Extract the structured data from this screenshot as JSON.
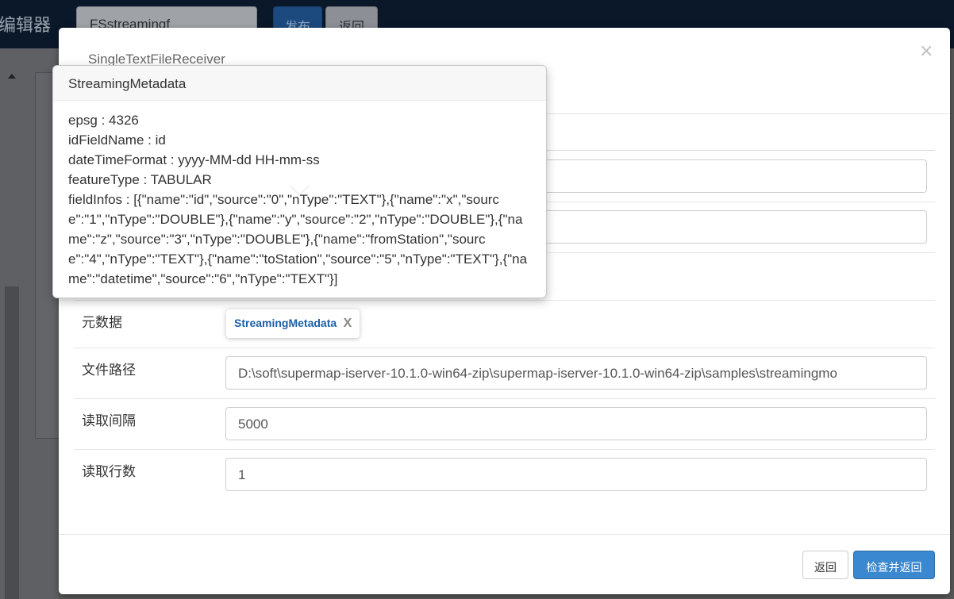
{
  "app": {
    "title": "编辑器",
    "name_value": "FSstreamingf",
    "publish_label": "发布",
    "back_label": "返回"
  },
  "modal": {
    "title": "SingleTextFileReceiver",
    "close_glyph": "×",
    "rows": {
      "metadata_label": "元数据",
      "metadata_tag": "StreamingMetadata",
      "metadata_tag_remove": "X",
      "filepath_label": "文件路径",
      "filepath_value": "D:\\soft\\supermap-iserver-10.1.0-win64-zip\\supermap-iserver-10.1.0-win64-zip\\samples\\streamingmo",
      "interval_label": "读取间隔",
      "interval_value": "5000",
      "lines_label": "读取行数",
      "lines_value": "1"
    },
    "footer": {
      "cancel_label": "返回",
      "confirm_label": "检查并返回"
    }
  },
  "popover": {
    "title": "StreamingMetadata",
    "lines": [
      "epsg : 4326",
      "idFieldName : id",
      "dateTimeFormat : yyyy-MM-dd HH-mm-ss",
      "featureType : TABULAR"
    ],
    "field_infos": "fieldInfos : [{\"name\":\"id\",\"source\":\"0\",\"nType\":\"TEXT\"},{\"name\":\"x\",\"source\":\"1\",\"nType\":\"DOUBLE\"},{\"name\":\"y\",\"source\":\"2\",\"nType\":\"DOUBLE\"},{\"name\":\"z\",\"source\":\"3\",\"nType\":\"DOUBLE\"},{\"name\":\"fromStation\",\"source\":\"4\",\"nType\":\"TEXT\"},{\"name\":\"toStation\",\"source\":\"5\",\"nType\":\"TEXT\"},{\"name\":\"datetime\",\"source\":\"6\",\"nType\":\"TEXT\"}]"
  },
  "colors": {
    "topbar": "#0b1829",
    "primary": "#3a88cf",
    "tag_text": "#1d5fa6"
  },
  "icons": {
    "close": "close-icon",
    "scroll_up": "caret-up-icon"
  }
}
